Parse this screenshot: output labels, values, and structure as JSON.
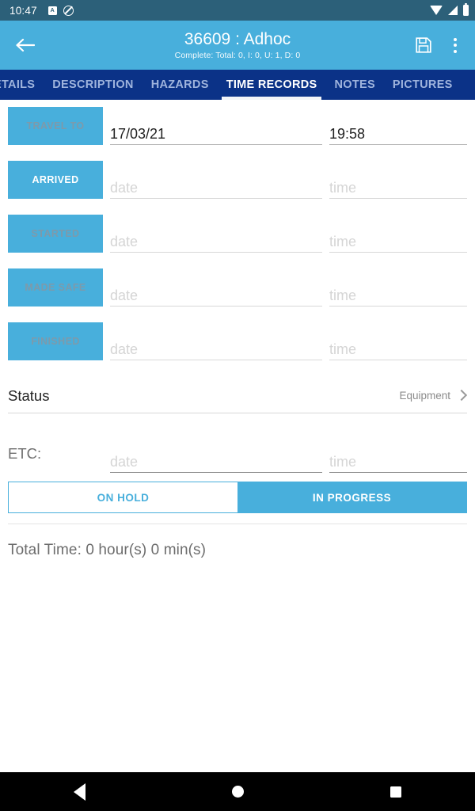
{
  "statusbar": {
    "time": "10:47",
    "left_icons": [
      "app-badge-icon",
      "do-not-disturb-icon"
    ],
    "right_icons": [
      "wifi-icon",
      "cell-signal-icon",
      "battery-icon"
    ],
    "background_color": "#2c6079"
  },
  "appbar": {
    "back_label": "Back",
    "title": "36609 : Adhoc",
    "subtitle": "Complete: Total: 0, I: 0, U: 1, D: 0",
    "save_label": "Save",
    "overflow_label": "More options",
    "background_color": "#48afdc"
  },
  "tabs": {
    "background_color": "#0b3287",
    "active_color": "#ffffff",
    "inactive_color": "#9fb4dd",
    "items": [
      {
        "label": "ETAILS",
        "active": false
      },
      {
        "label": "DESCRIPTION",
        "active": false
      },
      {
        "label": "HAZARDS",
        "active": false
      },
      {
        "label": "TIME RECORDS",
        "active": true
      },
      {
        "label": "NOTES",
        "active": false
      },
      {
        "label": "PICTURES",
        "active": false
      }
    ]
  },
  "time_records": {
    "rows": [
      {
        "label": "TRAVEL TO",
        "enabled": false,
        "date_value": "17/03/21",
        "date_placeholder": "date",
        "time_value": "19:58",
        "time_placeholder": "time"
      },
      {
        "label": "ARRIVED",
        "enabled": true,
        "date_value": "",
        "date_placeholder": "date",
        "time_value": "",
        "time_placeholder": "time"
      },
      {
        "label": "STARTED",
        "enabled": false,
        "date_value": "",
        "date_placeholder": "date",
        "time_value": "",
        "time_placeholder": "time"
      },
      {
        "label": "MADE SAFE",
        "enabled": false,
        "date_value": "",
        "date_placeholder": "date",
        "time_value": "",
        "time_placeholder": "time"
      },
      {
        "label": "FINISHED",
        "enabled": false,
        "date_value": "",
        "date_placeholder": "date",
        "time_value": "",
        "time_placeholder": "time"
      }
    ]
  },
  "status": {
    "label": "Status",
    "value": "Equipment",
    "chevron_icon": "chevron-right-icon"
  },
  "etc": {
    "label": "ETC:",
    "date_value": "",
    "date_placeholder": "date",
    "time_value": "",
    "time_placeholder": "time"
  },
  "toggle": {
    "on_hold_label": "ON HOLD",
    "in_progress_label": "IN PROGRESS",
    "selected": "IN PROGRESS",
    "accent_color": "#48afdc"
  },
  "summary": {
    "total_time": "Total Time:  0 hour(s) 0 min(s)"
  },
  "navbar": {
    "back_label": "Back",
    "home_label": "Home",
    "recents_label": "Recents"
  }
}
